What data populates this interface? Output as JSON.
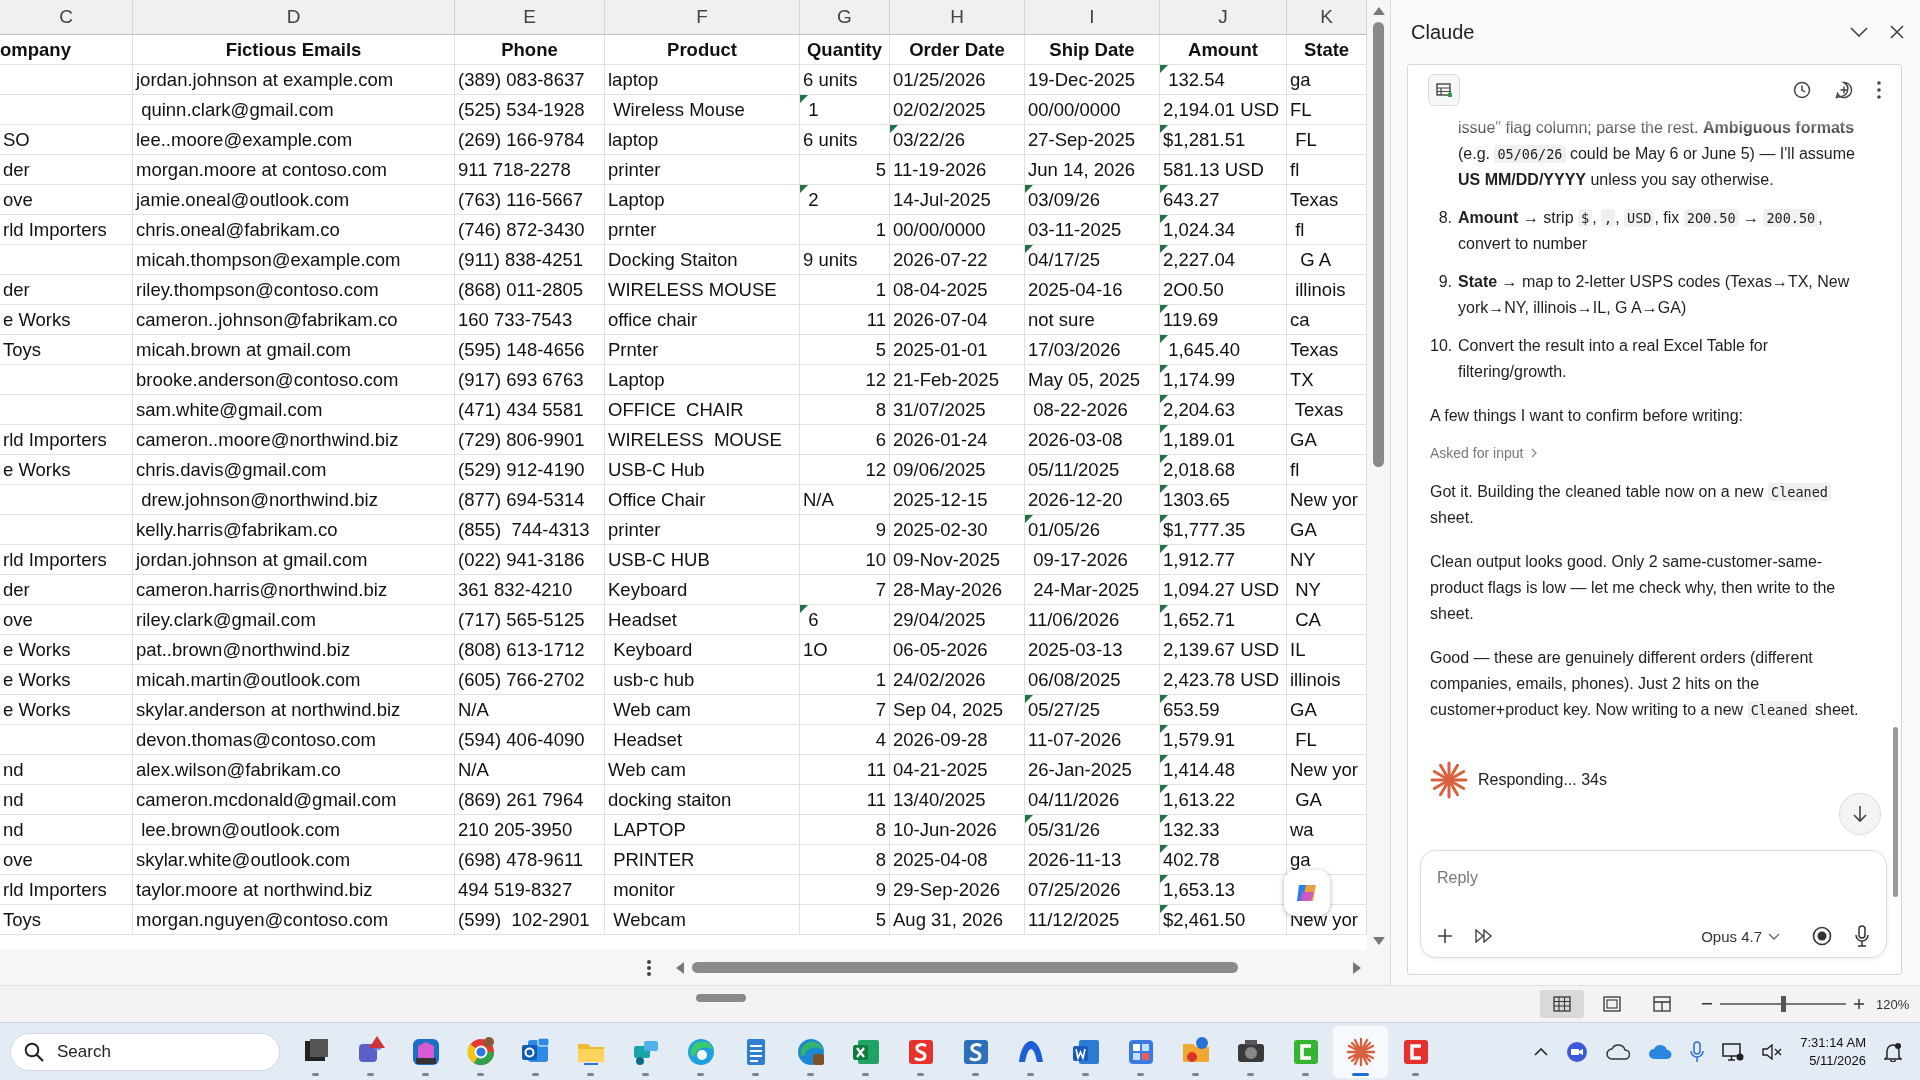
{
  "sheet": {
    "column_letters": [
      "C",
      "D",
      "E",
      "F",
      "G",
      "H",
      "I",
      "J",
      "K"
    ],
    "headers": [
      "ompany",
      "Fictious Emails",
      "Phone",
      "Product",
      "Quantity",
      "Order Date",
      "Ship Date",
      "Amount",
      "State"
    ],
    "rows": [
      {
        "email": "jordan.johnson at example.com",
        "phone": "(389) 083-8637",
        "product": "laptop",
        "quantity": "6 units",
        "qty_numeric": false,
        "order_date": "01/25/2026",
        "ship_date": "19-Dec-2025",
        "amount": " 132.54",
        "state": "ga",
        "flags": [
          false,
          false,
          false,
          true
        ]
      },
      {
        "email": " quinn.clark@gmail.com",
        "phone": "(525) 534-1928",
        "product": " Wireless Mouse",
        "quantity": " 1",
        "qty_numeric": false,
        "order_date": "02/02/2025",
        "ship_date": "00/00/0000",
        "amount": "2,194.01 USD",
        "state": "FL",
        "flags": [
          true,
          false,
          false,
          false
        ]
      },
      {
        "company": "SO",
        "email": "lee..moore@example.com",
        "phone": "(269) 166-9784",
        "product": "laptop",
        "quantity": "6 units",
        "qty_numeric": false,
        "order_date": "03/22/26",
        "ship_date": "27-Sep-2025",
        "amount": "$1,281.51",
        "state": " FL",
        "flags": [
          false,
          true,
          false,
          true
        ]
      },
      {
        "company": "der",
        "email": "morgan.moore at contoso.com",
        "phone": "911 718-2278",
        "product": "printer",
        "quantity": "5",
        "qty_numeric": true,
        "order_date": "11-19-2026",
        "ship_date": "Jun 14, 2026",
        "amount": "581.13 USD",
        "state": "fl",
        "flags": [
          false,
          false,
          false,
          false
        ]
      },
      {
        "company": "ove",
        "email": "jamie.oneal@outlook.com",
        "phone": "(763) 116-5667",
        "product": "Laptop",
        "quantity": " 2",
        "qty_numeric": false,
        "order_date": "14-Jul-2025",
        "ship_date": "03/09/26",
        "amount": "643.27",
        "state": "Texas",
        "flags": [
          true,
          false,
          true,
          true
        ]
      },
      {
        "company": "rld Importers",
        "email": "chris.oneal@fabrikam.co",
        "phone": "(746) 872-3430",
        "product": "prnter",
        "quantity": "1",
        "qty_numeric": true,
        "order_date": "00/00/0000",
        "ship_date": "03-11-2025",
        "amount": "1,024.34",
        "state": " fl",
        "flags": [
          false,
          false,
          false,
          true
        ]
      },
      {
        "email": "micah.thompson@example.com",
        "phone": "(911) 838-4251",
        "product": "Docking Staiton",
        "quantity": "9 units",
        "qty_numeric": false,
        "order_date": "2026-07-22",
        "ship_date": "04/17/25",
        "amount": "2,227.04",
        "state": "  G A",
        "flags": [
          false,
          false,
          true,
          true
        ]
      },
      {
        "company": "der",
        "email": "riley.thompson@contoso.com",
        "phone": "(868) 011-2805",
        "product": "WIRELESS MOUSE",
        "quantity": "1",
        "qty_numeric": true,
        "order_date": "08-04-2025",
        "ship_date": "2025-04-16",
        "amount": "2O0.50",
        "state": " illinois",
        "flags": [
          false,
          false,
          false,
          false
        ]
      },
      {
        "company": "e Works",
        "email": "cameron..johnson@fabrikam.co",
        "phone": "160 733-7543",
        "product": "office chair",
        "quantity": "11",
        "qty_numeric": true,
        "order_date": "2026-07-04",
        "ship_date": "not sure",
        "amount": "119.69",
        "state": "ca",
        "flags": [
          false,
          false,
          false,
          true
        ]
      },
      {
        "company": "Toys",
        "email": "micah.brown at gmail.com",
        "phone": "(595) 148-4656",
        "product": "Prnter",
        "quantity": "5",
        "qty_numeric": true,
        "order_date": "2025-01-01",
        "ship_date": "17/03/2026",
        "amount": " 1,645.40",
        "state": "Texas",
        "flags": [
          false,
          false,
          false,
          true
        ]
      },
      {
        "email": "brooke.anderson@contoso.com",
        "phone": "(917) 693 6763",
        "product": "Laptop",
        "quantity": "12",
        "qty_numeric": true,
        "order_date": "21-Feb-2025",
        "ship_date": "May 05, 2025",
        "amount": "1,174.99",
        "state": "TX",
        "flags": [
          false,
          false,
          false,
          true
        ]
      },
      {
        "email": "sam.white@gmail.com",
        "phone": "(471) 434 5581",
        "product": "OFFICE  CHAIR",
        "quantity": "8",
        "qty_numeric": true,
        "order_date": "31/07/2025",
        "ship_date": " 08-22-2026",
        "amount": "2,204.63",
        "state": " Texas",
        "flags": [
          false,
          false,
          false,
          true
        ]
      },
      {
        "company": "rld Importers",
        "email": "cameron..moore@northwind.biz",
        "phone": "(729) 806-9901",
        "product": "WIRELESS  MOUSE",
        "quantity": "6",
        "qty_numeric": true,
        "order_date": "2026-01-24",
        "ship_date": "2026-03-08",
        "amount": "1,189.01",
        "state": "GA",
        "flags": [
          false,
          false,
          false,
          true
        ]
      },
      {
        "company": "e Works",
        "email": "chris.davis@gmail.com",
        "phone": "(529) 912-4190",
        "product": "USB-C Hub",
        "quantity": "12",
        "qty_numeric": true,
        "order_date": "09/06/2025",
        "ship_date": "05/11/2025",
        "amount": "2,018.68",
        "state": "fl",
        "flags": [
          false,
          false,
          false,
          true
        ]
      },
      {
        "email": " drew.johnson@northwind.biz",
        "phone": "(877) 694-5314",
        "product": "Office Chair",
        "quantity": "N/A",
        "qty_numeric": false,
        "order_date": "2025-12-15",
        "ship_date": "2026-12-20",
        "amount": "1303.65",
        "state": "New yor",
        "flags": [
          false,
          false,
          false,
          true
        ]
      },
      {
        "email": "kelly.harris@fabrikam.co",
        "phone": "(855)  744-4313",
        "product": "printer",
        "quantity": "9",
        "qty_numeric": true,
        "order_date": "2025-02-30",
        "ship_date": "01/05/26",
        "amount": "$1,777.35",
        "state": "GA",
        "flags": [
          false,
          false,
          true,
          true
        ]
      },
      {
        "company": "rld Importers",
        "email": "jordan.johnson at gmail.com",
        "phone": "(022) 941-3186",
        "product": "USB-C HUB",
        "quantity": "10",
        "qty_numeric": true,
        "order_date": "09-Nov-2025",
        "ship_date": " 09-17-2026",
        "amount": "1,912.77",
        "state": "NY",
        "flags": [
          false,
          false,
          false,
          true
        ]
      },
      {
        "company": "der",
        "email": "cameron.harris@northwind.biz",
        "phone": "361 832-4210",
        "product": "Keyboard",
        "quantity": "7",
        "qty_numeric": true,
        "order_date": "28-May-2026",
        "ship_date": " 24-Mar-2025",
        "amount": "1,094.27 USD",
        "state": " NY",
        "flags": [
          false,
          false,
          false,
          false
        ]
      },
      {
        "company": "ove",
        "email": "riley.clark@gmail.com",
        "phone": "(717) 565-5125",
        "product": "Headset",
        "quantity": " 6",
        "qty_numeric": false,
        "order_date": "29/04/2025",
        "ship_date": "11/06/2026",
        "amount": "1,652.71",
        "state": " CA",
        "flags": [
          true,
          false,
          false,
          true
        ]
      },
      {
        "company": "e Works",
        "email": "pat..brown@northwind.biz",
        "phone": "(808) 613-1712",
        "product": " Keyboard",
        "quantity": "1O",
        "qty_numeric": false,
        "order_date": "06-05-2026",
        "ship_date": "2025-03-13",
        "amount": "2,139.67 USD",
        "state": "IL",
        "flags": [
          false,
          false,
          false,
          false
        ]
      },
      {
        "company": "e Works",
        "email": "micah.martin@outlook.com",
        "phone": "(605) 766-2702",
        "product": " usb-c hub",
        "quantity": "1",
        "qty_numeric": true,
        "order_date": "24/02/2026",
        "ship_date": "06/08/2025",
        "amount": "2,423.78 USD",
        "state": "illinois",
        "flags": [
          false,
          false,
          false,
          false
        ]
      },
      {
        "company": "e Works",
        "email": "skylar.anderson at northwind.biz",
        "phone": "N/A",
        "product": " Web cam",
        "quantity": "7",
        "qty_numeric": true,
        "order_date": "Sep 04, 2025",
        "ship_date": "05/27/25",
        "amount": "653.59",
        "state": "GA",
        "flags": [
          false,
          false,
          true,
          true
        ]
      },
      {
        "email": "devon.thomas@contoso.com",
        "phone": "(594) 406-4090",
        "product": " Headset",
        "quantity": "4",
        "qty_numeric": true,
        "order_date": "2026-09-28",
        "ship_date": "11-07-2026",
        "amount": "1,579.91",
        "state": " FL",
        "flags": [
          false,
          false,
          false,
          true
        ]
      },
      {
        "company": "nd",
        "email": "alex.wilson@fabrikam.co",
        "phone": "N/A",
        "product": "Web cam",
        "quantity": "11",
        "qty_numeric": true,
        "order_date": "04-21-2025",
        "ship_date": "26-Jan-2025",
        "amount": "1,414.48",
        "state": "New yor",
        "flags": [
          false,
          false,
          false,
          true
        ]
      },
      {
        "company": "nd",
        "email": "cameron.mcdonald@gmail.com",
        "phone": "(869) 261 7964",
        "product": "docking staiton",
        "quantity": "11",
        "qty_numeric": true,
        "order_date": "13/40/2025",
        "ship_date": "04/11/2026",
        "amount": "1,613.22",
        "state": " GA",
        "flags": [
          false,
          false,
          false,
          true
        ]
      },
      {
        "company": "nd",
        "email": " lee.brown@outlook.com",
        "phone": "210 205-3950",
        "product": " LAPTOP",
        "quantity": "8",
        "qty_numeric": true,
        "order_date": "10-Jun-2026",
        "ship_date": "05/31/26",
        "amount": "132.33",
        "state": "wa",
        "flags": [
          false,
          false,
          true,
          true
        ]
      },
      {
        "company": "ove",
        "email": "skylar.white@outlook.com",
        "phone": "(698) 478-9611",
        "product": " PRINTER",
        "quantity": "8",
        "qty_numeric": true,
        "order_date": "2025-04-08",
        "ship_date": "2026-11-13",
        "amount": "402.78",
        "state": "ga",
        "flags": [
          false,
          false,
          false,
          true
        ]
      },
      {
        "company": "rld Importers",
        "email": "taylor.moore at northwind.biz",
        "phone": "494 519-8327",
        "product": " monitor",
        "quantity": "9",
        "qty_numeric": true,
        "order_date": "29-Sep-2026",
        "ship_date": "07/25/2026",
        "amount": "1,653.13",
        "flags": [
          false,
          false,
          false,
          true
        ]
      },
      {
        "company": "Toys",
        "email": "morgan.nguyen@contoso.com",
        "phone": "(599)  102-2901",
        "product": " Webcam",
        "quantity": "5",
        "qty_numeric": true,
        "order_date": "Aug 31, 2026",
        "ship_date": "11/12/2025",
        "amount": "$2,461.50",
        "state": "New yor",
        "flags": [
          false,
          false,
          false,
          true
        ]
      }
    ]
  },
  "panel": {
    "title": "Claude",
    "messages": [
      {
        "kind": "list_item",
        "faded": true,
        "segments": [
          {
            "kind": "text",
            "text": "issue\" flag column; parse the rest. "
          },
          {
            "kind": "bold",
            "text": "Ambiguous formats"
          },
          {
            "kind": "text",
            "text": " (e.g. "
          },
          {
            "kind": "code",
            "text": "05/06/26"
          },
          {
            "kind": "text",
            "text": " could be May 6 or June 5) — I'll assume "
          },
          {
            "kind": "bold",
            "text": "US MM/DD/YYYY"
          },
          {
            "kind": "text",
            "text": " unless you say otherwise."
          }
        ]
      },
      {
        "kind": "list_item",
        "number": "8.",
        "segments": [
          {
            "kind": "bold",
            "text": "Amount"
          },
          {
            "kind": "text",
            "text": " → strip "
          },
          {
            "kind": "code",
            "text": "$"
          },
          {
            "kind": "text",
            "text": ", "
          },
          {
            "kind": "code",
            "text": ","
          },
          {
            "kind": "text",
            "text": ", "
          },
          {
            "kind": "code",
            "text": "USD"
          },
          {
            "kind": "text",
            "text": ", fix "
          },
          {
            "kind": "code",
            "text": "2O0.50"
          },
          {
            "kind": "text",
            "text": " → "
          },
          {
            "kind": "code",
            "text": "200.50"
          },
          {
            "kind": "text",
            "text": ", convert to number"
          }
        ]
      },
      {
        "kind": "list_item",
        "number": "9.",
        "segments": [
          {
            "kind": "bold",
            "text": "State"
          },
          {
            "kind": "text",
            "text": " → map to 2-letter USPS codes (Texas→TX, New york→NY, illinois→IL, G A→GA)"
          }
        ]
      },
      {
        "kind": "list_item",
        "number": "10.",
        "segments": [
          {
            "kind": "text",
            "text": "Convert the result into a real Excel Table for filtering/growth."
          }
        ]
      },
      {
        "kind": "paragraph",
        "segments": [
          {
            "kind": "text",
            "text": "A few things I want to confirm before writing:"
          }
        ]
      },
      {
        "kind": "link",
        "text": "Asked for input"
      },
      {
        "kind": "paragraph",
        "segments": [
          {
            "kind": "text",
            "text": "Got it. Building the cleaned table now on a new "
          },
          {
            "kind": "code",
            "text": "Cleaned"
          },
          {
            "kind": "text",
            "text": " sheet."
          }
        ]
      },
      {
        "kind": "paragraph",
        "segments": [
          {
            "kind": "text",
            "text": "Clean output looks good. Only 2 same-customer-same-product flags is low — let me check why, then write to the sheet."
          }
        ]
      },
      {
        "kind": "paragraph",
        "segments": [
          {
            "kind": "text",
            "text": "Good — these are genuinely different orders (different companies, emails, phones). Just 2 hits on the customer+product key. Now writing to a new "
          },
          {
            "kind": "code",
            "text": "Cleaned"
          },
          {
            "kind": "text",
            "text": " sheet."
          }
        ]
      },
      {
        "kind": "status",
        "text": "Responding... 34s"
      }
    ],
    "reply": {
      "placeholder": "Reply",
      "model": "Opus 4.7"
    }
  },
  "status_bar": {
    "views": [
      {
        "selected": true
      },
      {
        "selected": false
      },
      {
        "selected": false
      }
    ],
    "zoom": {
      "level": 0.5,
      "reading": "120%"
    }
  },
  "taskbar": {
    "search": {
      "placeholder": "Search"
    },
    "apps": [
      {
        "selected": false
      },
      {
        "selected": false
      },
      {
        "selected": false
      },
      {
        "selected": false
      },
      {
        "selected": false
      },
      {
        "selected": false
      },
      {
        "selected": false
      },
      {
        "selected": false
      },
      {
        "selected": false
      },
      {
        "selected": false
      },
      {
        "selected": false
      },
      {
        "selected": false
      },
      {
        "selected": false
      },
      {
        "selected": false
      },
      {
        "selected": false
      },
      {
        "selected": false
      },
      {
        "selected": false
      },
      {
        "selected": false
      },
      {
        "selected": false
      },
      {
        "selected": true
      },
      {
        "selected": false
      }
    ],
    "time": "7:31:14 AM",
    "date": "5/11/2026"
  }
}
